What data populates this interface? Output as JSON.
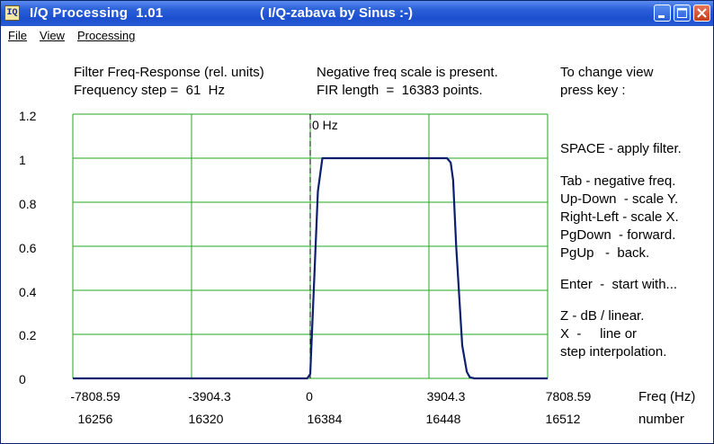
{
  "window": {
    "title": "I/Q Processing  1.01",
    "subtitle": "( I/Q-zabava by Sinus :-)",
    "icon_label": "IQ",
    "buttons": {
      "minimize": "minimize-icon",
      "maximize": "maximize-icon",
      "close": "close-icon"
    }
  },
  "menu": {
    "items": [
      {
        "first": "F",
        "rest": "ile"
      },
      {
        "first": "V",
        "rest": "iew"
      },
      {
        "first": "P",
        "rest": "rocessing"
      }
    ]
  },
  "info": {
    "line1_col1": "Filter Freq-Response (rel. units)",
    "line2_col1": "Frequency step =  61  Hz",
    "line1_col2": "Negative freq scale is present.",
    "line2_col2": "FIR length  =  16383 points."
  },
  "help": {
    "lines": [
      "To change view",
      "press key :",
      "SPACE - apply filter.",
      "Tab - negative freq.",
      "Up-Down  - scale Y.",
      "Right-Left - scale X.",
      "PgDown  - forward.",
      "PgUp   -  back.",
      "Enter  -  start with...",
      "Z - dB / linear.",
      "X  -     line or",
      "step interpolation."
    ]
  },
  "chart_data": {
    "type": "line",
    "title": "",
    "xlabel": "Freq (Hz)",
    "x2label": "number",
    "marker_label": "0 Hz",
    "xlim": [
      -7808.59,
      7808.59
    ],
    "ylim": [
      0,
      1.2
    ],
    "yticks": [
      "1.2",
      "1",
      "0.8",
      "0.6",
      "0.4",
      "0.2",
      "0"
    ],
    "xticks": [
      "-7808.59",
      "-3904.3",
      "0",
      "3904.3",
      "7808.59"
    ],
    "x2ticks": [
      "16256",
      "16320",
      "16384",
      "16448",
      "16512"
    ],
    "grid": true,
    "colors": {
      "grid": "#22aa22",
      "line": "#0b1f6e",
      "marker": "#000000"
    },
    "series": [
      {
        "x": [
          -7808.59,
          -100,
          0,
          100,
          250,
          400,
          500,
          600,
          3700,
          4500,
          4620,
          4700,
          4800,
          5000,
          5150,
          5250,
          5400,
          7808.59
        ],
        "y": [
          0,
          0,
          0.02,
          0.35,
          0.85,
          1.0,
          1.0,
          1.0,
          1.0,
          1.0,
          0.98,
          0.9,
          0.6,
          0.15,
          0.03,
          0.005,
          0,
          0
        ]
      }
    ]
  }
}
